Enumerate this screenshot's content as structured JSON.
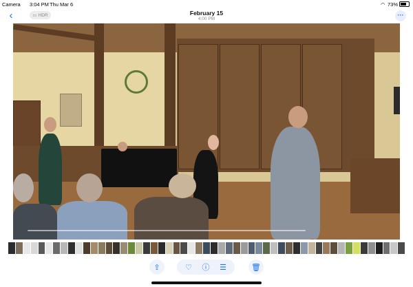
{
  "status_bar": {
    "app": "Camera",
    "time": "3:04 PM",
    "date": "Thu Mar 6",
    "battery": "73%"
  },
  "nav": {
    "hdr_label": "HDR",
    "title": "February 15",
    "subtitle": "4:00 PM"
  },
  "colors": {
    "accent": "#1a73e8",
    "chip_bg": "#eef2fb"
  },
  "icons": {
    "back": "chevron-left-icon",
    "more": "ellipsis-icon",
    "play": "play-icon",
    "mute": "speaker-muted-icon",
    "share": "share-icon",
    "favorite": "heart-icon",
    "info": "info-icon",
    "adjust": "sliders-icon",
    "delete": "trash-icon"
  },
  "filmstrip": {
    "thumb_colors": [
      "#2c2c2c",
      "#7d6c57",
      "#e8e8e8",
      "#d8d8d8",
      "#5a5a5a",
      "#e8e8e8",
      "#6a6a6a",
      "#b8b8b8",
      "#2f2f2f",
      "#e0e0e0",
      "#4d3b2b",
      "#a58b6b",
      "#8a7a5e",
      "#5b4a36",
      "#37302a",
      "#9a8b74",
      "#6b8a3a",
      "#c9c9a8",
      "#3a3a3a",
      "#7a5a3a",
      "#2b2b2b",
      "#d9d0b8",
      "#6a5544",
      "#4b4b4b",
      "#e6e6e6",
      "#8c7b62",
      "#3c4b5c",
      "#2d2d2d",
      "#a9a9a9",
      "#5c6a7a",
      "#6a5a48",
      "#9b9b9b",
      "#4d5d6d",
      "#7a8a9a",
      "#5a6a4a",
      "#bfbfbf",
      "#3d4d5d",
      "#6d5d4d",
      "#2e2e2e",
      "#8a9aaa",
      "#c2b59b",
      "#434343",
      "#9a7a5a",
      "#5d4d3d",
      "#b5b5b5",
      "#7aa040",
      "#d4e060",
      "#3b3b3b",
      "#8f8f8f",
      "#1f1f1f",
      "#6f6f6f",
      "#c8c8c8",
      "#4a4a4a"
    ]
  }
}
